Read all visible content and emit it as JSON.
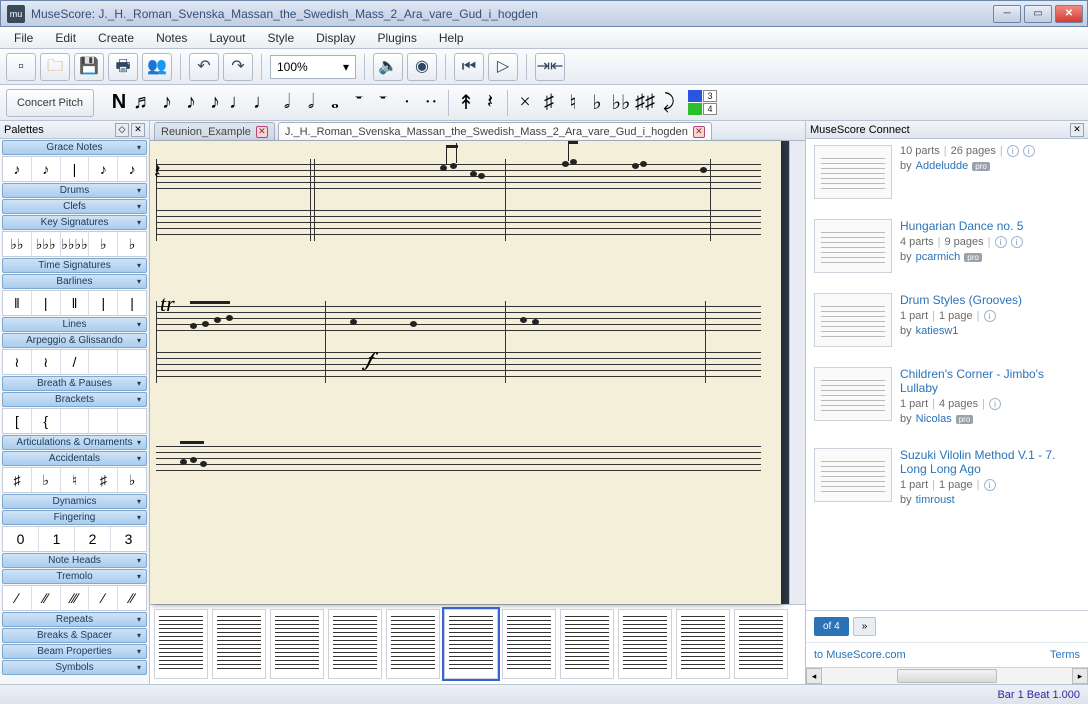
{
  "app": {
    "title": "MuseScore: J._H._Roman_Svenska_Massan_the_Swedish_Mass_2_Ara_vare_Gud_i_hogden",
    "icon_label": "mu"
  },
  "menu": [
    "File",
    "Edit",
    "Create",
    "Notes",
    "Layout",
    "Style",
    "Display",
    "Plugins",
    "Help"
  ],
  "toolbar": {
    "zoom_value": "100%",
    "icons": [
      "new-file",
      "open-folder",
      "save",
      "print",
      "parts",
      "sep",
      "undo",
      "redo",
      "sep",
      "zoom",
      "sep",
      "speaker",
      "midi",
      "sep",
      "rewind",
      "play",
      "sep",
      "repeat-toggle"
    ]
  },
  "notebar": {
    "concert_pitch": "Concert Pitch",
    "glyphs": [
      "N",
      "♬",
      "♪",
      "♪",
      "♪",
      "♩",
      "♩",
      "𝅗𝅥",
      "𝅗𝅥",
      "𝅝",
      "𝄻",
      "𝄻",
      "·",
      "··",
      "sep",
      "↟",
      "𝄽",
      "sep",
      "×",
      "♯",
      "♮",
      "♭",
      "♭♭",
      "♯♯",
      "⤸"
    ],
    "voice_labels": {
      "v3": "3",
      "v4": "4"
    }
  },
  "palettes": {
    "title": "Palettes",
    "categories": [
      {
        "name": "Grace Notes",
        "open": true,
        "cells": [
          "♪",
          "♪",
          "|",
          "♪",
          "♪"
        ]
      },
      {
        "name": "Drums",
        "open": false
      },
      {
        "name": "Clefs",
        "open": false
      },
      {
        "name": "Key Signatures",
        "open": true,
        "cells": [
          "♭♭",
          "♭♭♭",
          "♭♭♭♭",
          "♭",
          "♭"
        ]
      },
      {
        "name": "Time Signatures",
        "open": false
      },
      {
        "name": "Barlines",
        "open": true,
        "cells": [
          "‖",
          "|",
          "‖",
          "|",
          "|"
        ]
      },
      {
        "name": "Lines",
        "open": false
      },
      {
        "name": "Arpeggio & Glissando",
        "open": true,
        "cells": [
          "≀",
          "≀",
          "/",
          "",
          ""
        ]
      },
      {
        "name": "Breath & Pauses",
        "open": false
      },
      {
        "name": "Brackets",
        "open": true,
        "cells": [
          "[",
          "{",
          "",
          "",
          ""
        ]
      },
      {
        "name": "Articulations & Ornaments",
        "open": false
      },
      {
        "name": "Accidentals",
        "open": true,
        "cells": [
          "♯",
          "♭",
          "♮",
          "♯",
          "♭"
        ]
      },
      {
        "name": "Dynamics",
        "open": false
      },
      {
        "name": "Fingering",
        "open": true,
        "cells": [
          "0",
          "1",
          "2",
          "3"
        ]
      },
      {
        "name": "Note Heads",
        "open": false
      },
      {
        "name": "Tremolo",
        "open": true,
        "cells": [
          "∕",
          "∕∕",
          "∕∕∕",
          "∕",
          "∕∕"
        ]
      },
      {
        "name": "Repeats",
        "open": false
      },
      {
        "name": "Breaks & Spacer",
        "open": false
      },
      {
        "name": "Beam Properties",
        "open": false
      },
      {
        "name": "Symbols",
        "open": false
      }
    ]
  },
  "tabs": [
    {
      "label": "Reunion_Example",
      "active": false
    },
    {
      "label": "J._H._Roman_Svenska_Massan_the_Swedish_Mass_2_Ara_vare_Gud_i_hogden",
      "active": true
    }
  ],
  "score": {
    "tr_marking": "tr",
    "dynamic": "𝆑"
  },
  "connect": {
    "title": "MuseScore Connect",
    "items": [
      {
        "title": "",
        "parts": "10 parts",
        "pages": "26 pages",
        "by": "by",
        "author": "Addeludde",
        "pro": true,
        "icons": 2
      },
      {
        "title": "Hungarian Dance no. 5",
        "parts": "4 parts",
        "pages": "9 pages",
        "by": "by",
        "author": "pcarmich",
        "pro": true,
        "icons": 2
      },
      {
        "title": "Drum Styles (Grooves)",
        "parts": "1 part",
        "pages": "1 page",
        "by": "by",
        "author": "katiesw1",
        "pro": false,
        "icons": 1
      },
      {
        "title": "Children's Corner - Jimbo's Lullaby",
        "parts": "1 part",
        "pages": "4 pages",
        "by": "by",
        "author": "Nicolas",
        "pro": true,
        "icons": 1
      },
      {
        "title": "Suzuki Vilolin Method V.1 - 7. Long Long Ago",
        "parts": "1 part",
        "pages": "1 page",
        "by": "by",
        "author": "timroust",
        "pro": false,
        "icons": 1
      }
    ],
    "pager": {
      "label": "of 4",
      "next": "»"
    },
    "footer": {
      "link": "to MuseScore.com",
      "terms": "Terms"
    }
  },
  "status": {
    "text": "Bar  1 Beat  1.000"
  }
}
